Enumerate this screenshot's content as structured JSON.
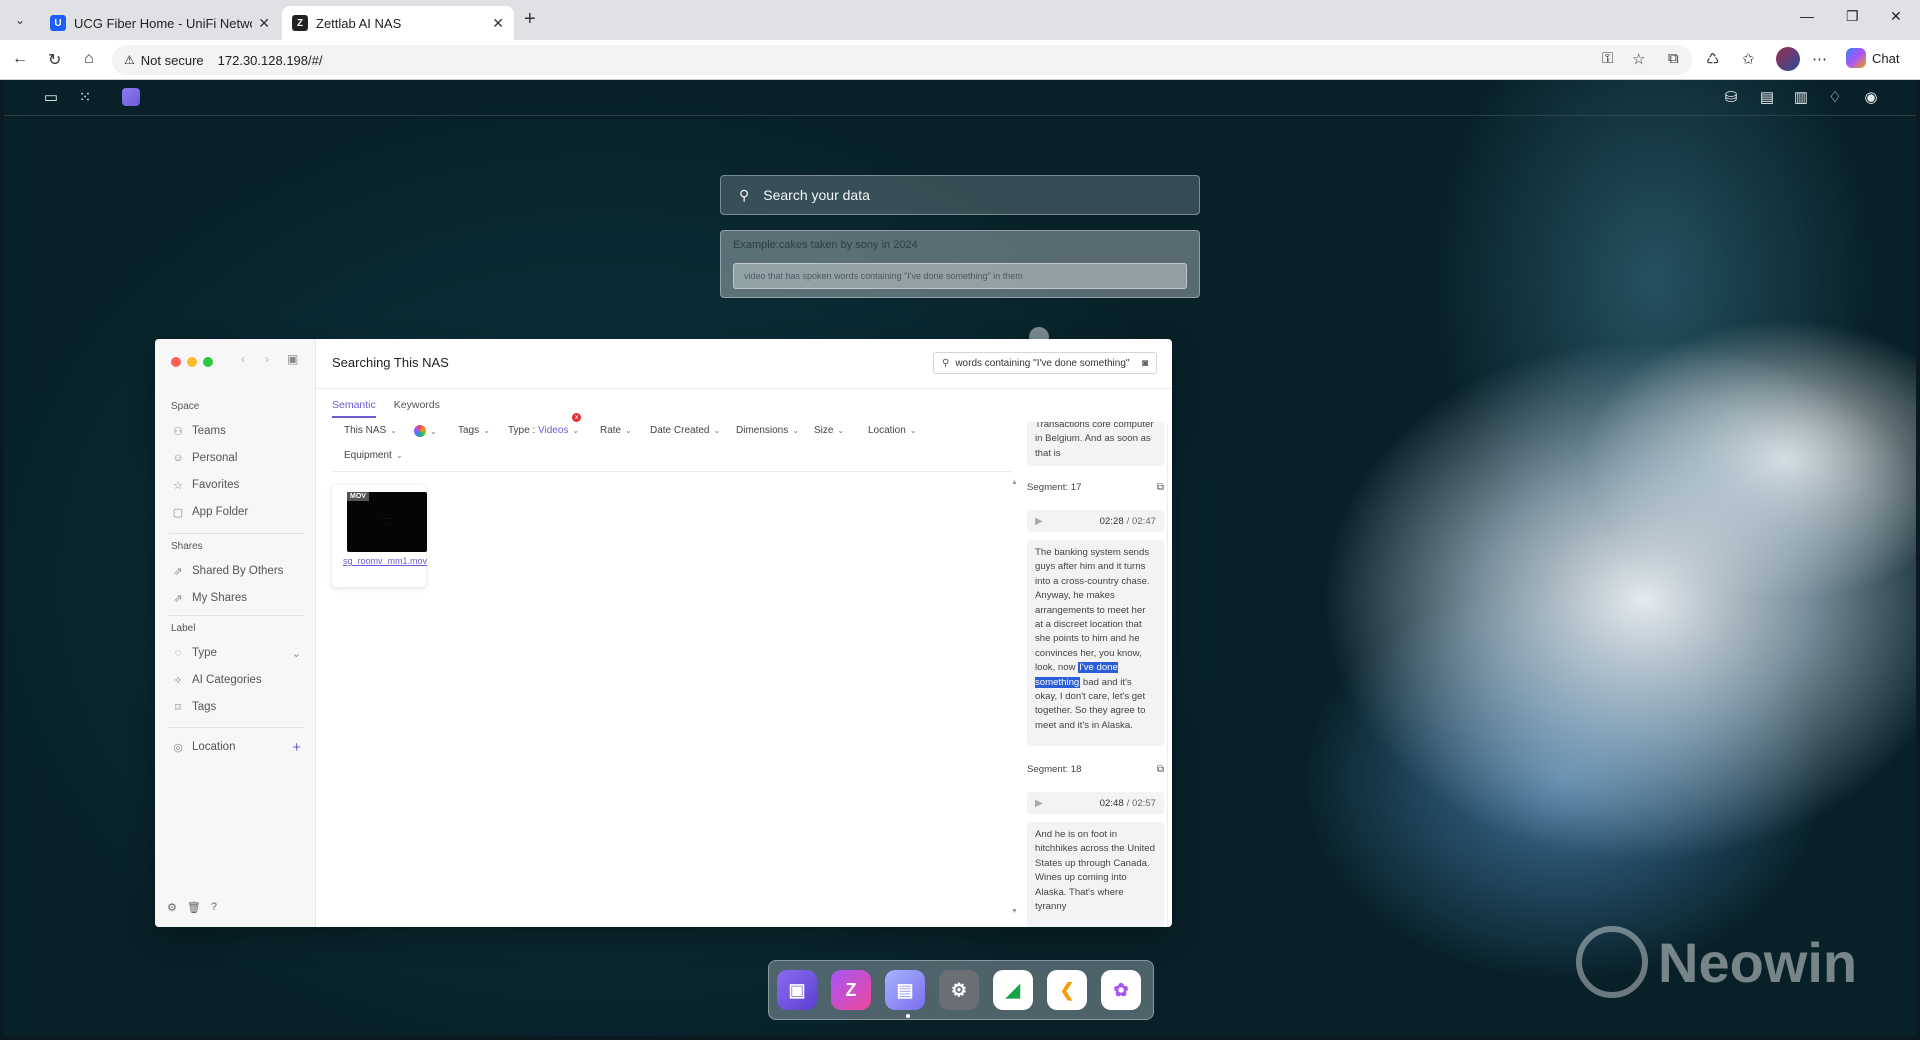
{
  "browser": {
    "tabs": [
      {
        "title": "UCG Fiber Home - UniFi Network",
        "favicon": "U"
      },
      {
        "title": "Zettlab AI NAS",
        "favicon": "Z"
      }
    ],
    "address": {
      "security": "Not secure",
      "url": "172.30.128.198/#/"
    },
    "chat_label": "Chat"
  },
  "desktop": {
    "search_placeholder": "Search your data",
    "example_label": "Example:cakes taken by sony in 2024",
    "example_query": "video that has spoken words containing \"I've done something\" in them"
  },
  "window": {
    "title": "Searching This NAS",
    "search_value": "words containing \"I've done something\"",
    "sidebar": {
      "space_label": "Space",
      "space_items": [
        {
          "label": "Teams",
          "icon": "teams-icon"
        },
        {
          "label": "Personal",
          "icon": "person-icon"
        },
        {
          "label": "Favorites",
          "icon": "star-icon"
        },
        {
          "label": "App Folder",
          "icon": "folder-icon"
        }
      ],
      "shares_label": "Shares",
      "shares_items": [
        {
          "label": "Shared By Others",
          "icon": "share-icon"
        },
        {
          "label": "My Shares",
          "icon": "share-icon"
        }
      ],
      "label_label": "Label",
      "label_items": [
        {
          "label": "Type",
          "icon": "type-icon"
        },
        {
          "label": "AI Categories",
          "icon": "ai-icon"
        },
        {
          "label": "Tags",
          "icon": "tag-icon"
        }
      ],
      "location_label": "Location"
    },
    "tabs": {
      "semantic": "Semantic",
      "keywords": "Keywords"
    },
    "filters": {
      "this_nas": "This NAS",
      "tags": "Tags",
      "type_prefix": "Type : ",
      "type_value": "Videos",
      "type_badge": "x",
      "rate": "Rate",
      "date_created": "Date Created",
      "dimensions": "Dimensions",
      "size": "Size",
      "location": "Location",
      "equipment": "Equipment"
    },
    "file": {
      "badge": "MOV",
      "name": "sg_roomv_mm1.mov"
    },
    "transcript": {
      "top_text": "Transactions core computer in Belgium. And as soon as that is",
      "segments": [
        {
          "label": "Segment: 17",
          "time": "02:28",
          "total": "/ 02:47",
          "text_before": "The banking system sends guys after him and it turns into a cross-country chase. Anyway, he makes arrangements to meet her at a discreet location that she points to him and he convinces her, you know, look, now ",
          "highlight": "I've done something",
          "text_after": " bad and it's okay, I don't care, let's get together. So they agree to meet and it's in Alaska."
        },
        {
          "label": "Segment: 18",
          "time": "02:48",
          "total": "/ 02:57",
          "text": "And he is on foot in hitchhikes across the United States up through Canada. Wines up coming into Alaska. That's where tyranny"
        }
      ]
    }
  },
  "watermark": "Neowin"
}
